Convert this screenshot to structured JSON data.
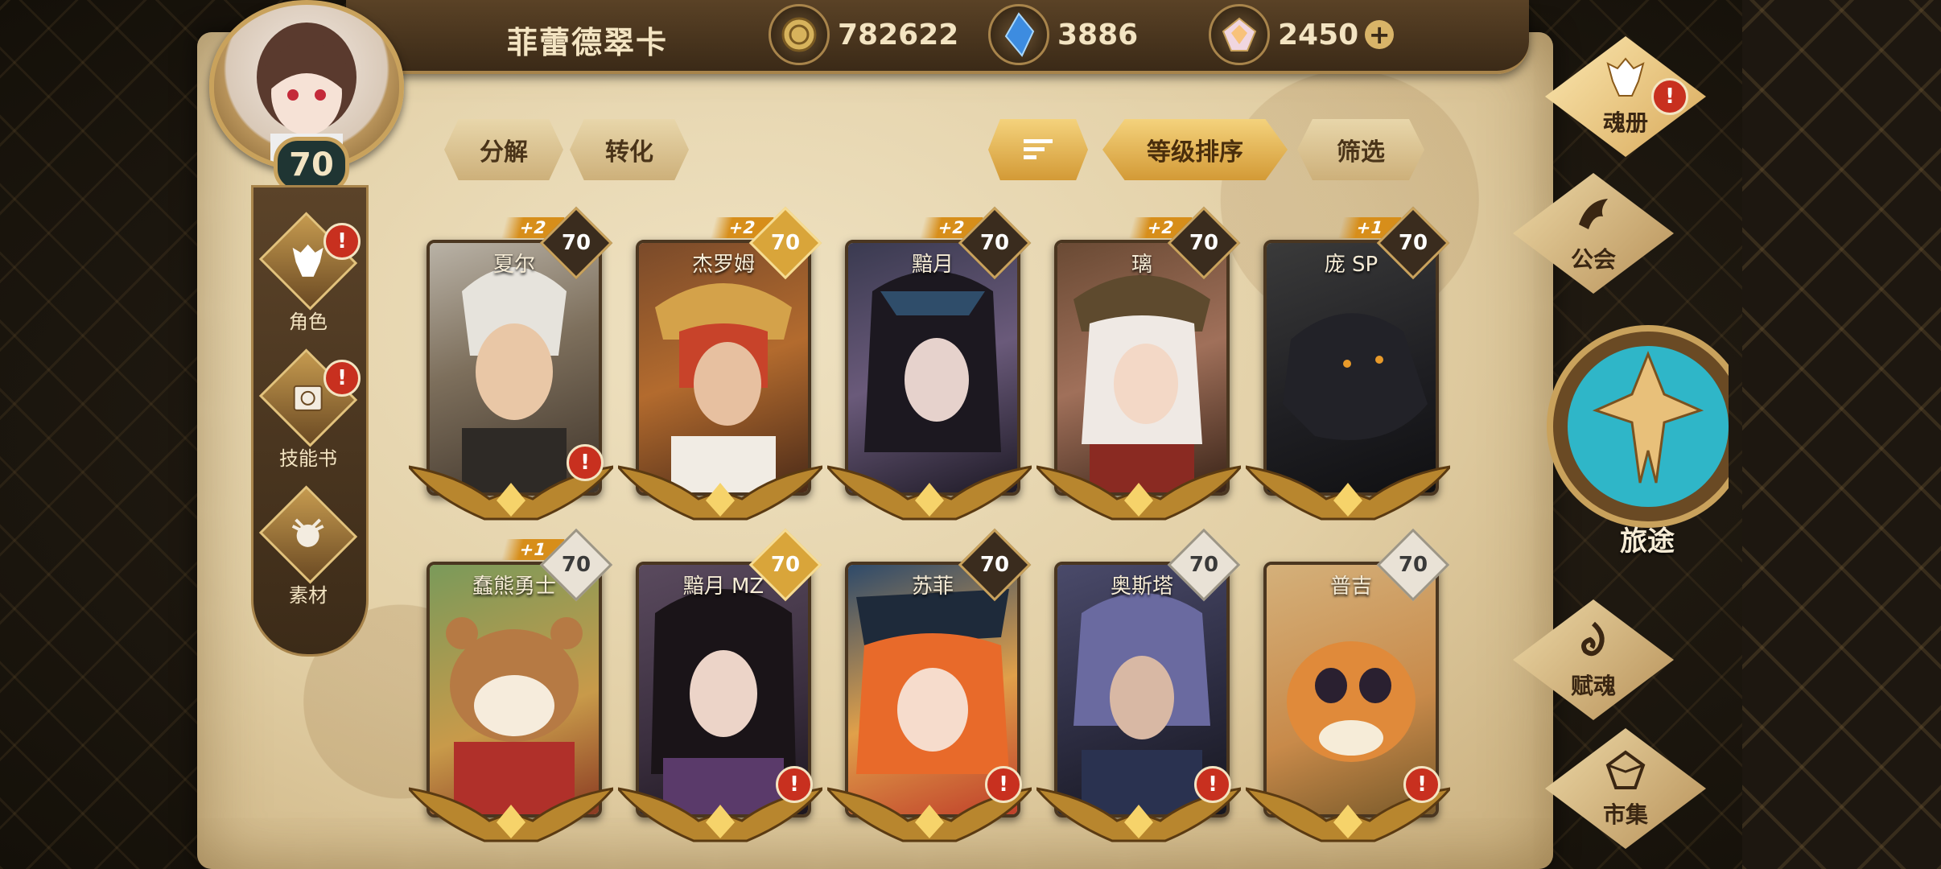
{
  "header": {
    "player_name": "菲蕾德翠卡",
    "player_level": "70",
    "resources": [
      {
        "icon": "gold-coin-icon",
        "value": "782622"
      },
      {
        "icon": "blue-crystal-icon",
        "value": "3886"
      },
      {
        "icon": "rainbow-gem-icon",
        "value": "2450"
      }
    ],
    "add_label": "+"
  },
  "left_menu": [
    {
      "label": "角色",
      "icon": "character-icon",
      "alert": true
    },
    {
      "label": "技能书",
      "icon": "skill-book-icon",
      "alert": true
    },
    {
      "label": "素材",
      "icon": "material-icon",
      "alert": false
    }
  ],
  "actions": {
    "decompose": "分解",
    "convert": "转化",
    "sort_icon": "sort-icon",
    "sort_by_level": "等级排序",
    "filter": "筛选"
  },
  "cards": [
    {
      "name": "夏尔",
      "level": "70",
      "plus": "+2",
      "level_style": "dark",
      "alert": true
    },
    {
      "name": "杰罗姆",
      "level": "70",
      "plus": "+2",
      "level_style": "gold",
      "alert": false
    },
    {
      "name": "黯月",
      "level": "70",
      "plus": "+2",
      "level_style": "dark",
      "alert": false
    },
    {
      "name": "璃",
      "level": "70",
      "plus": "+2",
      "level_style": "dark",
      "alert": false
    },
    {
      "name": "庞 SP",
      "level": "70",
      "plus": "+1",
      "level_style": "dark",
      "alert": false
    },
    {
      "name": "蠢熊勇士",
      "level": "70",
      "plus": "+1",
      "level_style": "light",
      "alert": false
    },
    {
      "name": "黯月 MZ",
      "level": "70",
      "plus": "",
      "level_style": "gold",
      "alert": true
    },
    {
      "name": "苏菲",
      "level": "70",
      "plus": "",
      "level_style": "dark",
      "alert": true
    },
    {
      "name": "奥斯塔",
      "level": "70",
      "plus": "",
      "level_style": "light",
      "alert": true
    },
    {
      "name": "普吉",
      "level": "70",
      "plus": "",
      "level_style": "light",
      "alert": true
    }
  ],
  "right_menu": [
    {
      "label": "魂册",
      "icon": "soul-book-icon",
      "alert": true
    },
    {
      "label": "公会",
      "icon": "guild-icon",
      "alert": false
    },
    {
      "label": "旅途",
      "icon": "journey-emblem-icon",
      "alert": false
    },
    {
      "label": "赋魂",
      "icon": "soul-imbue-icon",
      "alert": false
    },
    {
      "label": "市集",
      "icon": "market-gem-icon",
      "alert": false
    }
  ],
  "colors": {
    "parchment": "#e8d8b4",
    "frame_brown": "#3b2a17",
    "gold_accent": "#c9a25c",
    "alert_red": "#c8301f",
    "journey_teal": "#2fb6c8"
  }
}
